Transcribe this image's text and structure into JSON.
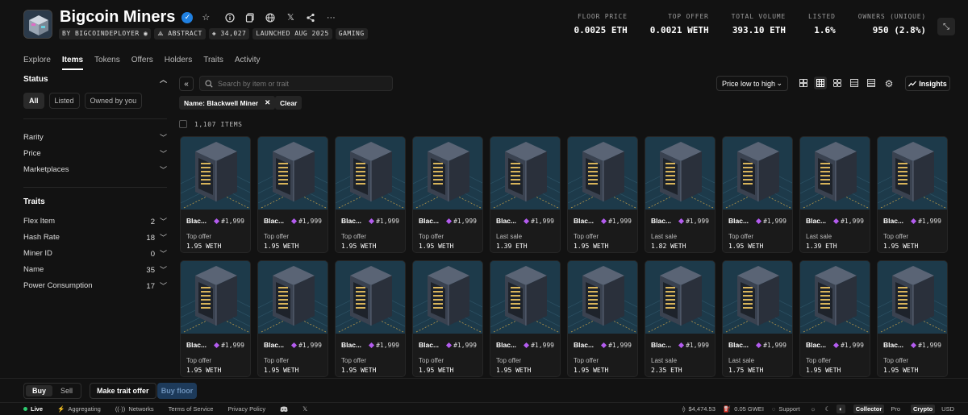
{
  "collection": {
    "title": "Bigcoin Miners",
    "chips": [
      "BY BIGCOINDEPLOYER",
      "ABSTRACT",
      "34,027",
      "LAUNCHED AUG 2025",
      "GAMING"
    ]
  },
  "stats": [
    {
      "label": "FLOOR PRICE",
      "value": "0.0025 ETH"
    },
    {
      "label": "TOP OFFER",
      "value": "0.0021 WETH"
    },
    {
      "label": "TOTAL VOLUME",
      "value": "393.10 ETH"
    },
    {
      "label": "LISTED",
      "value": "1.6%"
    },
    {
      "label": "OWNERS (UNIQUE)",
      "value": "950 (2.8%)"
    }
  ],
  "tabs": [
    "Explore",
    "Items",
    "Tokens",
    "Offers",
    "Holders",
    "Traits",
    "Activity"
  ],
  "sidebar": {
    "status_title": "Status",
    "status_pills": [
      "All",
      "Listed",
      "Owned by you"
    ],
    "filters": [
      "Rarity",
      "Price",
      "Marketplaces"
    ],
    "traits_title": "Traits",
    "traits": [
      {
        "name": "Flex Item",
        "count": "2"
      },
      {
        "name": "Hash Rate",
        "count": "18"
      },
      {
        "name": "Miner ID",
        "count": "0"
      },
      {
        "name": "Name",
        "count": "35"
      },
      {
        "name": "Power Consumption",
        "count": "17"
      }
    ]
  },
  "toolbar": {
    "search_placeholder": "Search by item or trait",
    "sort_label": "Price low to high",
    "insights_label": "Insights",
    "filter_chip": "Name: Blackwell Miner",
    "clear_label": "Clear",
    "items_count": "1,107 ITEMS"
  },
  "items": [
    {
      "name": "Blac...",
      "rank": "#1,999",
      "label": "Top offer",
      "price": "1.95 WETH"
    },
    {
      "name": "Blac...",
      "rank": "#1,999",
      "label": "Top offer",
      "price": "1.95 WETH"
    },
    {
      "name": "Blac...",
      "rank": "#1,999",
      "label": "Top offer",
      "price": "1.95 WETH"
    },
    {
      "name": "Blac...",
      "rank": "#1,999",
      "label": "Top offer",
      "price": "1.95 WETH"
    },
    {
      "name": "Blac...",
      "rank": "#1,999",
      "label": "Last sale",
      "price": "1.39 ETH"
    },
    {
      "name": "Blac...",
      "rank": "#1,999",
      "label": "Top offer",
      "price": "1.95 WETH"
    },
    {
      "name": "Blac...",
      "rank": "#1,999",
      "label": "Last sale",
      "price": "1.82 WETH"
    },
    {
      "name": "Blac...",
      "rank": "#1,999",
      "label": "Top offer",
      "price": "1.95 WETH"
    },
    {
      "name": "Blac...",
      "rank": "#1,999",
      "label": "Last sale",
      "price": "1.39 ETH"
    },
    {
      "name": "Blac...",
      "rank": "#1,999",
      "label": "Top offer",
      "price": "1.95 WETH"
    },
    {
      "name": "Blac...",
      "rank": "#1,999",
      "label": "Top offer",
      "price": "1.95 WETH"
    },
    {
      "name": "Blac...",
      "rank": "#1,999",
      "label": "Top offer",
      "price": "1.95 WETH"
    },
    {
      "name": "Blac...",
      "rank": "#1,999",
      "label": "Top offer",
      "price": "1.95 WETH"
    },
    {
      "name": "Blac...",
      "rank": "#1,999",
      "label": "Top offer",
      "price": "1.95 WETH"
    },
    {
      "name": "Blac...",
      "rank": "#1,999",
      "label": "Top offer",
      "price": "1.95 WETH"
    },
    {
      "name": "Blac...",
      "rank": "#1,999",
      "label": "Top offer",
      "price": "1.95 WETH"
    },
    {
      "name": "Blac...",
      "rank": "#1,999",
      "label": "Last sale",
      "price": "2.35 ETH"
    },
    {
      "name": "Blac...",
      "rank": "#1,999",
      "label": "Last sale",
      "price": "1.75 WETH"
    },
    {
      "name": "Blac...",
      "rank": "#1,999",
      "label": "Top offer",
      "price": "1.95 WETH"
    },
    {
      "name": "Blac...",
      "rank": "#1,999",
      "label": "Top offer",
      "price": "1.95 WETH"
    }
  ],
  "actions": {
    "buy": "Buy",
    "sell": "Sell",
    "trait_offer": "Make trait offer",
    "buy_floor": "Buy floor"
  },
  "footer": {
    "live": "Live",
    "aggregating": "Aggregating",
    "networks": "Networks",
    "terms": "Terms of Service",
    "privacy": "Privacy Policy",
    "eth_price": "$4,474.53",
    "gas": "0.05 GWEI",
    "support": "Support",
    "mode_collector": "Collector",
    "mode_pro": "Pro",
    "cur_crypto": "Crypto",
    "cur_usd": "USD"
  },
  "colors": {
    "accent": "#2081e2",
    "rank_diamond": "#b45cf0",
    "card_bg": "#1d3a4a",
    "live": "#2ecc71"
  }
}
